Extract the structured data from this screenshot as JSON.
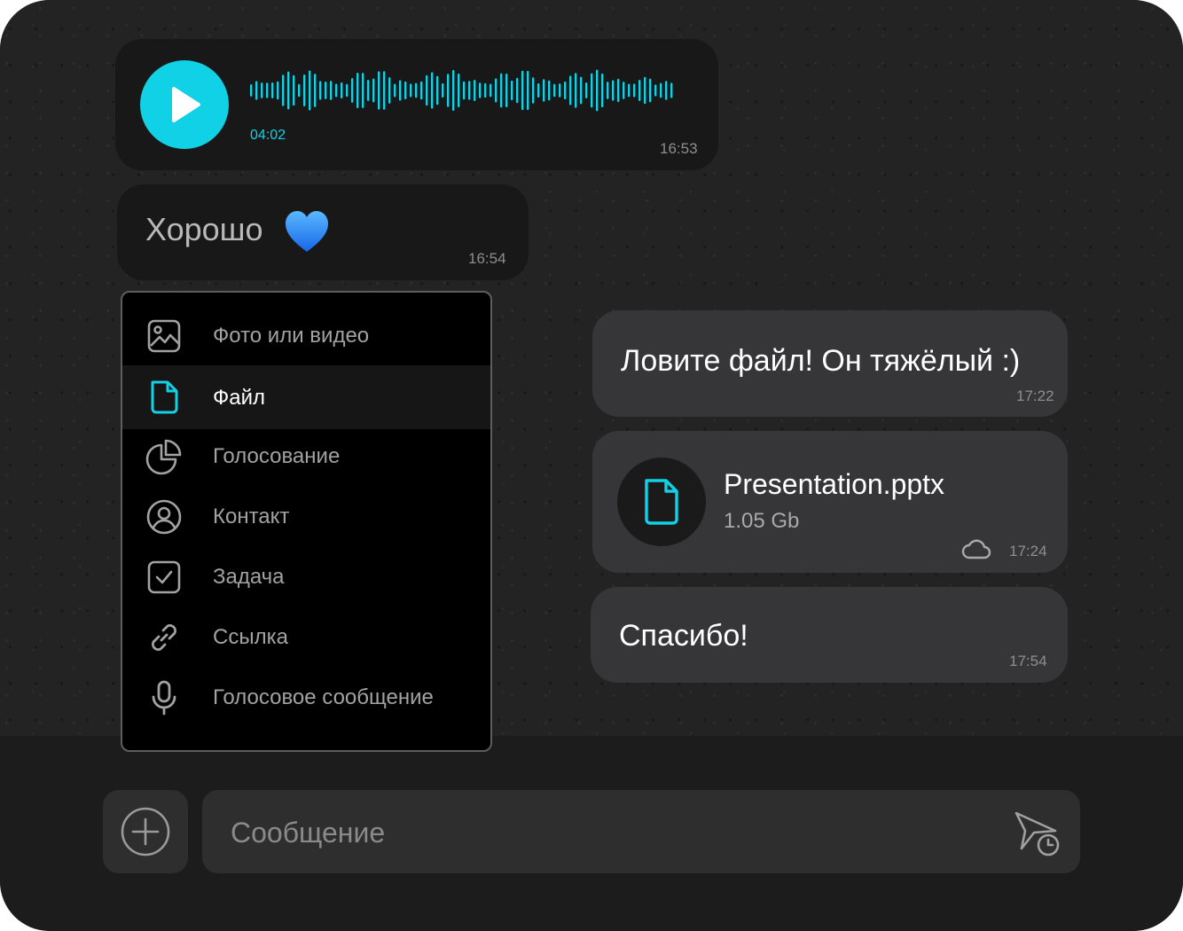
{
  "voice_message": {
    "duration": "04:02",
    "time": "16:53",
    "icon": "play-icon",
    "accent_color": "#10d1e6"
  },
  "incoming_text": {
    "text": "Хорошо",
    "emoji": "blue-heart-icon",
    "time": "16:54"
  },
  "attach_menu": {
    "items": [
      {
        "label": "Фото или видео",
        "icon": "photo-icon",
        "selected": false
      },
      {
        "label": "Файл",
        "icon": "file-icon",
        "selected": true
      },
      {
        "label": "Голосование",
        "icon": "poll-icon",
        "selected": false
      },
      {
        "label": "Контакт",
        "icon": "contact-icon",
        "selected": false
      },
      {
        "label": "Задача",
        "icon": "task-icon",
        "selected": false
      },
      {
        "label": "Ссылка",
        "icon": "link-icon",
        "selected": false
      },
      {
        "label": "Голосовое сообщение",
        "icon": "microphone-icon",
        "selected": false
      }
    ]
  },
  "outgoing": [
    {
      "text": "Ловите файл! Он тяжёлый :)",
      "time": "17:22"
    },
    {
      "file_name": "Presentation.pptx",
      "file_size": "1.05 Gb",
      "time": "17:24",
      "status_icon": "cloud-icon"
    },
    {
      "text": "Спасибо!",
      "time": "17:54"
    }
  ],
  "composer": {
    "placeholder": "Сообщение",
    "add_icon": "plus-circle-icon",
    "send_icon": "scheduled-send-icon"
  }
}
